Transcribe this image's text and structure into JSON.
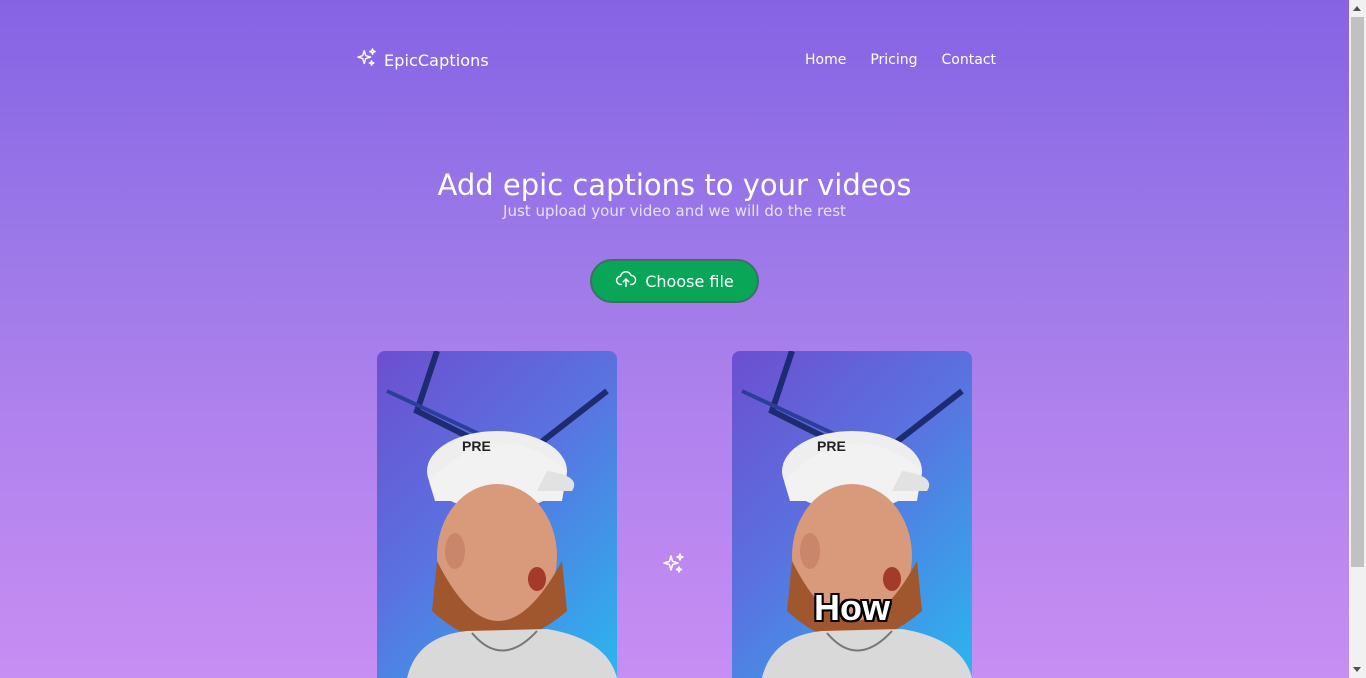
{
  "header": {
    "logo_icon": "sparkles-icon",
    "logo_text": "EpicCaptions",
    "nav": [
      {
        "label": "Home"
      },
      {
        "label": "Pricing"
      },
      {
        "label": "Contact"
      }
    ]
  },
  "hero": {
    "title": "Add epic captions to your videos",
    "subtitle": "Just upload your video and we will do the rest"
  },
  "upload": {
    "icon": "cloud-upload-icon",
    "label": "Choose file",
    "color": "#0aa657"
  },
  "preview": {
    "caption_text": "How",
    "separator_icon": "sparkles-icon"
  },
  "colors": {
    "background_top": "#8563e4",
    "background_bottom": "#c78ef3",
    "button": "#0aa657"
  }
}
